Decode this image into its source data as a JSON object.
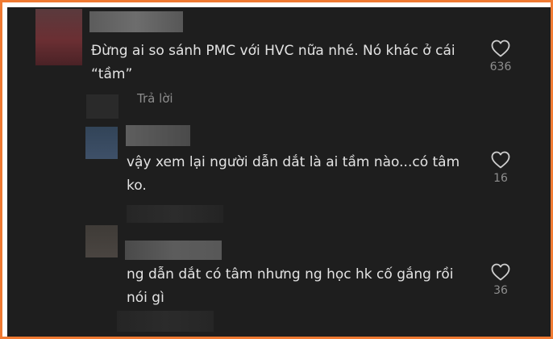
{
  "comments": [
    {
      "text": "Đừng ai so sánh PMC với HVC nữa nhé. Nó khác ở cái “tầm”",
      "likes": "636",
      "reply_label": "Trả lời"
    },
    {
      "text": "vậy xem lại người dẫn dắt là ai tầm nào...có tâm ko.",
      "likes": "16"
    },
    {
      "text": "ng dẫn dắt có tâm nhưng ng học hk cố gắng rồi nói gì",
      "likes": "36"
    }
  ],
  "icons": {
    "like": "heart-outline-icon"
  },
  "colors": {
    "frame": "#f07a32",
    "background": "#1e1e1e"
  }
}
